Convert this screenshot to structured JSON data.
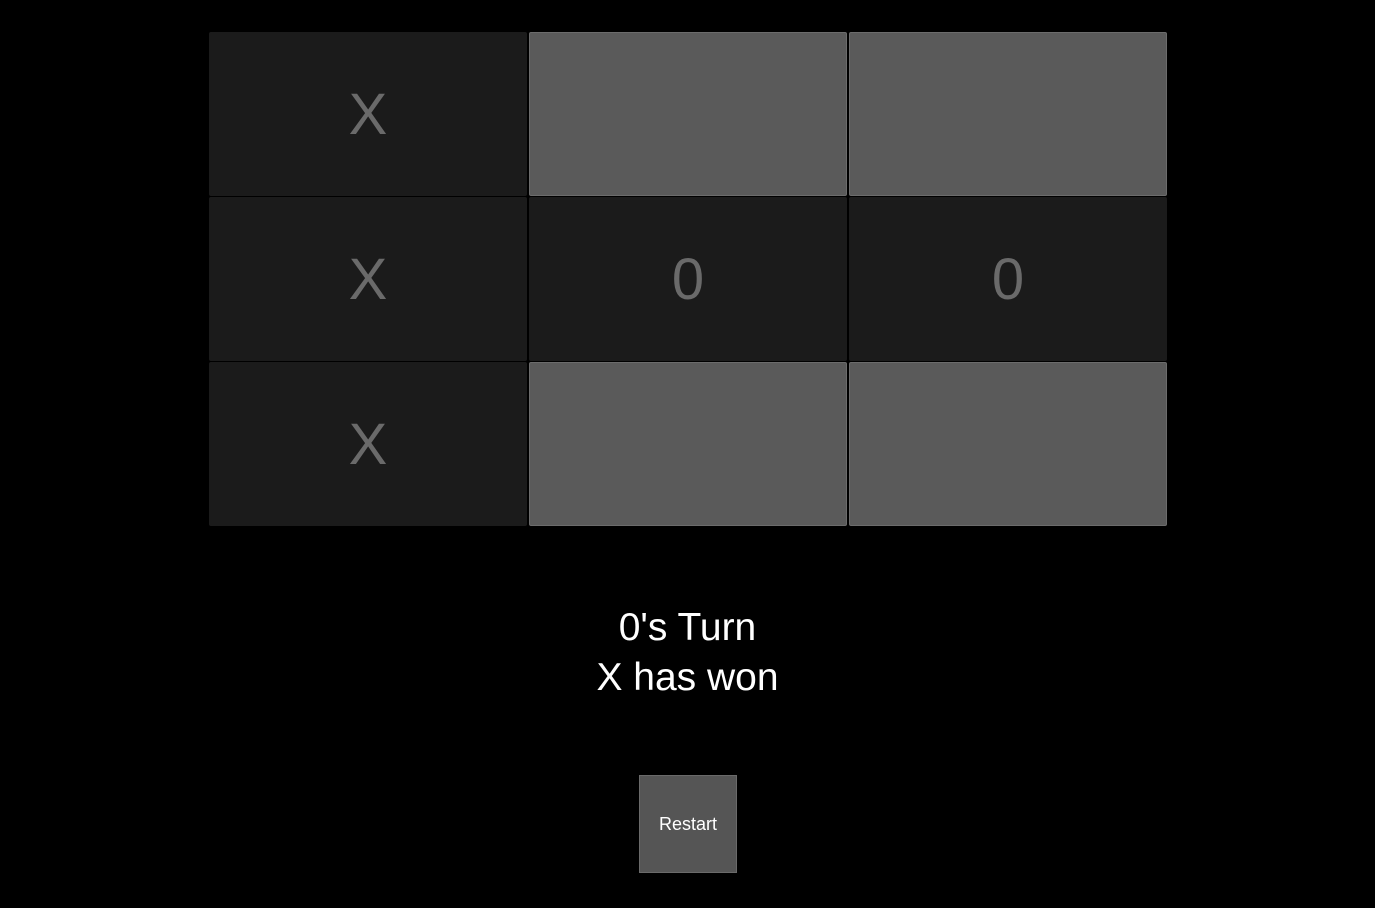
{
  "board": {
    "cells": [
      [
        "X",
        "",
        ""
      ],
      [
        "X",
        "0",
        "0"
      ],
      [
        "X",
        "",
        ""
      ]
    ]
  },
  "status": {
    "turn_text": "0's Turn",
    "result_text": "X has won"
  },
  "controls": {
    "restart_label": "Restart"
  },
  "colors": {
    "background": "#000000",
    "filled_cell": "#1b1b1b",
    "empty_cell": "#5a5a5a",
    "mark": "#6a6a6a",
    "text": "#ffffff",
    "button": "#555555"
  }
}
